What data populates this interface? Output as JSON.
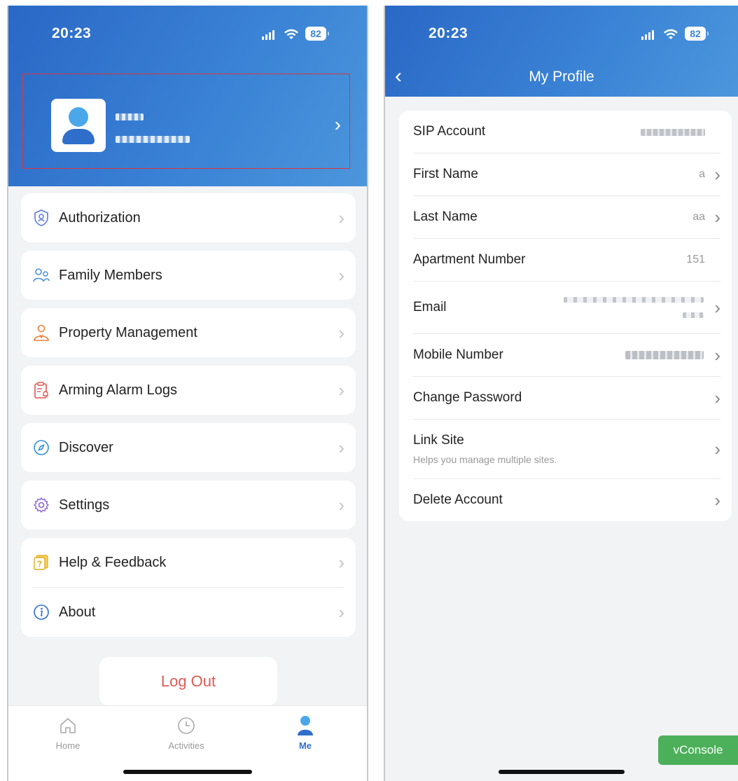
{
  "status_bar": {
    "time": "20:23",
    "battery": "82"
  },
  "left_screen": {
    "menu": [
      {
        "label": "Authorization",
        "icon": "shield-user-icon"
      },
      {
        "label": "Family Members",
        "icon": "family-icon"
      },
      {
        "label": "Property Management",
        "icon": "property-manager-icon"
      },
      {
        "label": "Arming Alarm Logs",
        "icon": "alarm-log-icon"
      },
      {
        "label": "Discover",
        "icon": "compass-icon"
      },
      {
        "label": "Settings",
        "icon": "gear-icon"
      },
      {
        "label": "Help & Feedback",
        "icon": "help-icon"
      },
      {
        "label": "About",
        "icon": "info-icon"
      }
    ],
    "logout_label": "Log Out",
    "tabs": [
      {
        "label": "Home",
        "icon": "home-icon"
      },
      {
        "label": "Activities",
        "icon": "clock-icon"
      },
      {
        "label": "Me",
        "icon": "user-icon"
      }
    ],
    "active_tab": "Me"
  },
  "right_screen": {
    "title": "My Profile",
    "rows": {
      "sip": {
        "label": "SIP Account"
      },
      "first_name": {
        "label": "First Name",
        "value": "a"
      },
      "last_name": {
        "label": "Last Name",
        "value": "aa"
      },
      "apartment": {
        "label": "Apartment Number",
        "value": "151"
      },
      "email": {
        "label": "Email"
      },
      "mobile": {
        "label": "Mobile Number"
      },
      "change_password": {
        "label": "Change Password"
      },
      "link_site": {
        "label": "Link Site",
        "sub": "Helps you manage multiple sites."
      },
      "delete_account": {
        "label": "Delete Account"
      }
    },
    "vconsole_label": "vConsole"
  },
  "colors": {
    "header_blue": "#2f6fcb",
    "logout_red": "#e05a54",
    "vconsole_green": "#4cb05a",
    "highlight_red": "#d9363e"
  }
}
